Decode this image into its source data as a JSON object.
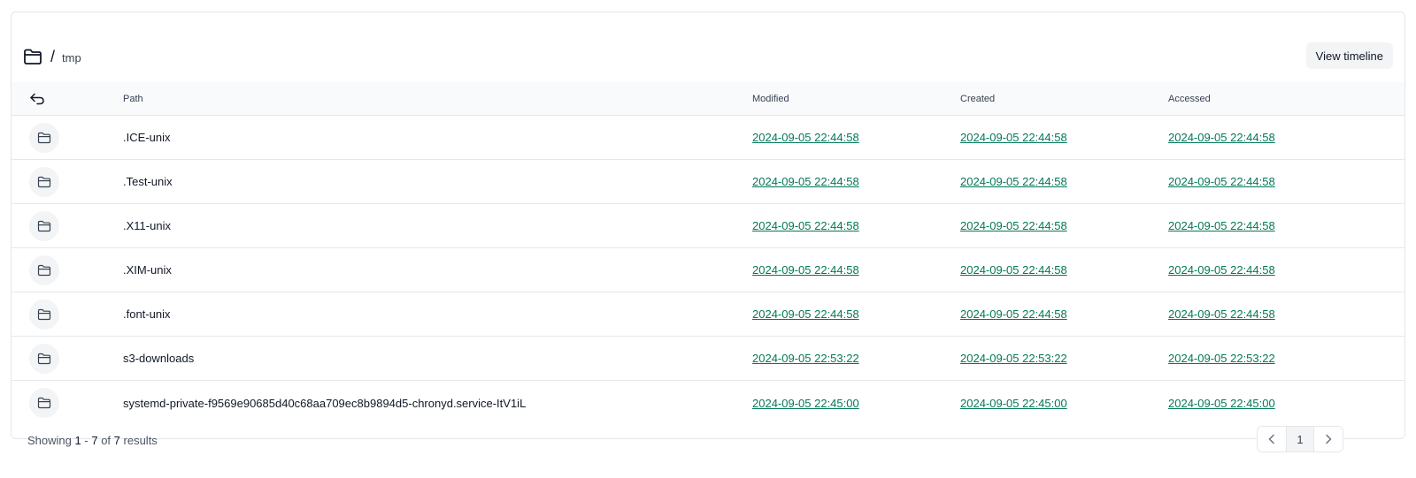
{
  "breadcrumb": {
    "root_icon": "folder-icon",
    "separator": "/",
    "segments": [
      "tmp"
    ]
  },
  "header": {
    "view_timeline_label": "View timeline"
  },
  "table": {
    "back_icon": "back-arrow-icon",
    "columns": {
      "path": "Path",
      "modified": "Modified",
      "created": "Created",
      "accessed": "Accessed"
    },
    "rows": [
      {
        "icon": "folder-icon",
        "name": ".ICE-unix",
        "modified": "2024-09-05 22:44:58",
        "created": "2024-09-05 22:44:58",
        "accessed": "2024-09-05 22:44:58"
      },
      {
        "icon": "folder-icon",
        "name": ".Test-unix",
        "modified": "2024-09-05 22:44:58",
        "created": "2024-09-05 22:44:58",
        "accessed": "2024-09-05 22:44:58"
      },
      {
        "icon": "folder-icon",
        "name": ".X11-unix",
        "modified": "2024-09-05 22:44:58",
        "created": "2024-09-05 22:44:58",
        "accessed": "2024-09-05 22:44:58"
      },
      {
        "icon": "folder-icon",
        "name": ".XIM-unix",
        "modified": "2024-09-05 22:44:58",
        "created": "2024-09-05 22:44:58",
        "accessed": "2024-09-05 22:44:58"
      },
      {
        "icon": "folder-icon",
        "name": ".font-unix",
        "modified": "2024-09-05 22:44:58",
        "created": "2024-09-05 22:44:58",
        "accessed": "2024-09-05 22:44:58"
      },
      {
        "icon": "folder-icon",
        "name": "s3-downloads",
        "modified": "2024-09-05 22:53:22",
        "created": "2024-09-05 22:53:22",
        "accessed": "2024-09-05 22:53:22"
      },
      {
        "icon": "folder-icon",
        "name": "systemd-private-f9569e90685d40c68aa709ec8b9894d5-chronyd.service-ItV1iL",
        "modified": "2024-09-05 22:45:00",
        "created": "2024-09-05 22:45:00",
        "accessed": "2024-09-05 22:45:00"
      }
    ]
  },
  "footer": {
    "showing_prefix": "Showing",
    "range_start": "1",
    "range_dash": "-",
    "range_end": "7",
    "of_word": "of",
    "total": "7",
    "results_word": "results",
    "current_page": "1",
    "prev_icon": "chevron-left-icon",
    "next_icon": "chevron-right-icon"
  },
  "colors": {
    "link": "#047857",
    "border": "#e5e7eb",
    "header_bg": "#f9fafb",
    "chip_bg": "#f3f4f6"
  }
}
